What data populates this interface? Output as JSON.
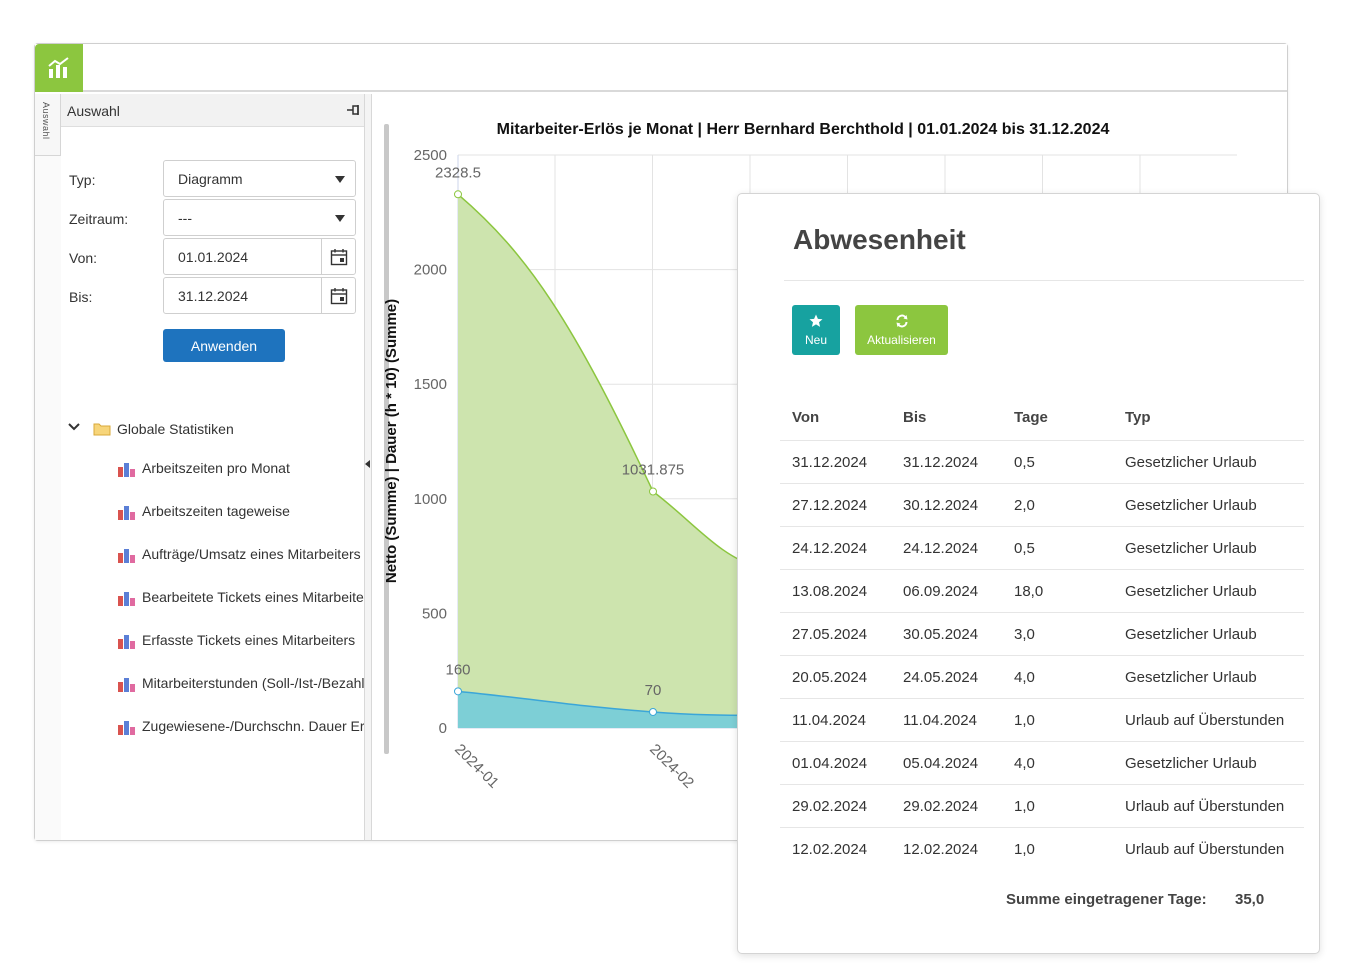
{
  "colors": {
    "brand_green": "#8cc63f",
    "primary_blue": "#1e73be",
    "teal": "#17a2a0",
    "area_green": "#cde4ae",
    "line_green": "#8cc63f",
    "area_blue": "#7dcfd6",
    "line_blue": "#3ba6d8"
  },
  "app": {
    "logo_icon": "chart-icon"
  },
  "sidebar": {
    "tab_label": "Auswahl"
  },
  "panel": {
    "title": "Auswahl",
    "pin_icon": "pin-icon",
    "typ": {
      "label": "Typ:",
      "value": "Diagramm"
    },
    "zeitraum": {
      "label": "Zeitraum:",
      "value": "---"
    },
    "von": {
      "label": "Von:",
      "value": "01.01.2024"
    },
    "bis": {
      "label": "Bis:",
      "value": "31.12.2024"
    },
    "apply_label": "Anwenden",
    "tree": {
      "root_label": "Globale Statistiken",
      "items": [
        "Arbeitszeiten pro Monat",
        "Arbeitszeiten tageweise",
        "Aufträge/Umsatz eines Mitarbeiters",
        "Bearbeitete Tickets eines Mitarbeiters",
        "Erfasste Tickets eines Mitarbeiters",
        "Mitarbeiterstunden (Soll-/Ist-/Bezahlt)",
        "Zugewiesene-/Durchschn. Dauer Erfasst"
      ]
    }
  },
  "chart_data": {
    "type": "area",
    "title": "Mitarbeiter-Erlös je Monat | Herr Bernhard Berchthold | 01.01.2024 bis 31.12.2024",
    "ylabel": "Netto (Summe) | Dauer (h * 10) (Summe)",
    "xlabel": "",
    "ylim": [
      0,
      2500
    ],
    "yticks": [
      0,
      500,
      1000,
      1500,
      2000,
      2500
    ],
    "categories": [
      "2024-01",
      "2024-02"
    ],
    "grid": true,
    "series": [
      {
        "values": [
          2328.5,
          1031.875
        ],
        "color": "#8cc63f",
        "fill": "#cde4ae"
      },
      {
        "values": [
          160,
          70
        ],
        "color": "#3ba6d8",
        "fill": "#7dcfd6"
      }
    ]
  },
  "absence": {
    "title": "Abwesenheit",
    "buttons": {
      "neu": "Neu",
      "aktualisieren": "Aktualisieren"
    },
    "columns": [
      "Von",
      "Bis",
      "Tage",
      "Typ"
    ],
    "rows": [
      [
        "31.12.2024",
        "31.12.2024",
        "0,5",
        "Gesetzlicher Urlaub"
      ],
      [
        "27.12.2024",
        "30.12.2024",
        "2,0",
        "Gesetzlicher Urlaub"
      ],
      [
        "24.12.2024",
        "24.12.2024",
        "0,5",
        "Gesetzlicher Urlaub"
      ],
      [
        "13.08.2024",
        "06.09.2024",
        "18,0",
        "Gesetzlicher Urlaub"
      ],
      [
        "27.05.2024",
        "30.05.2024",
        "3,0",
        "Gesetzlicher Urlaub"
      ],
      [
        "20.05.2024",
        "24.05.2024",
        "4,0",
        "Gesetzlicher Urlaub"
      ],
      [
        "11.04.2024",
        "11.04.2024",
        "1,0",
        "Urlaub auf Überstunden"
      ],
      [
        "01.04.2024",
        "05.04.2024",
        "4,0",
        "Gesetzlicher Urlaub"
      ],
      [
        "29.02.2024",
        "29.02.2024",
        "1,0",
        "Urlaub auf Überstunden"
      ],
      [
        "12.02.2024",
        "12.02.2024",
        "1,0",
        "Urlaub auf Überstunden"
      ]
    ],
    "sum_label": "Summe eingetragener Tage:",
    "sum_value": "35,0"
  }
}
